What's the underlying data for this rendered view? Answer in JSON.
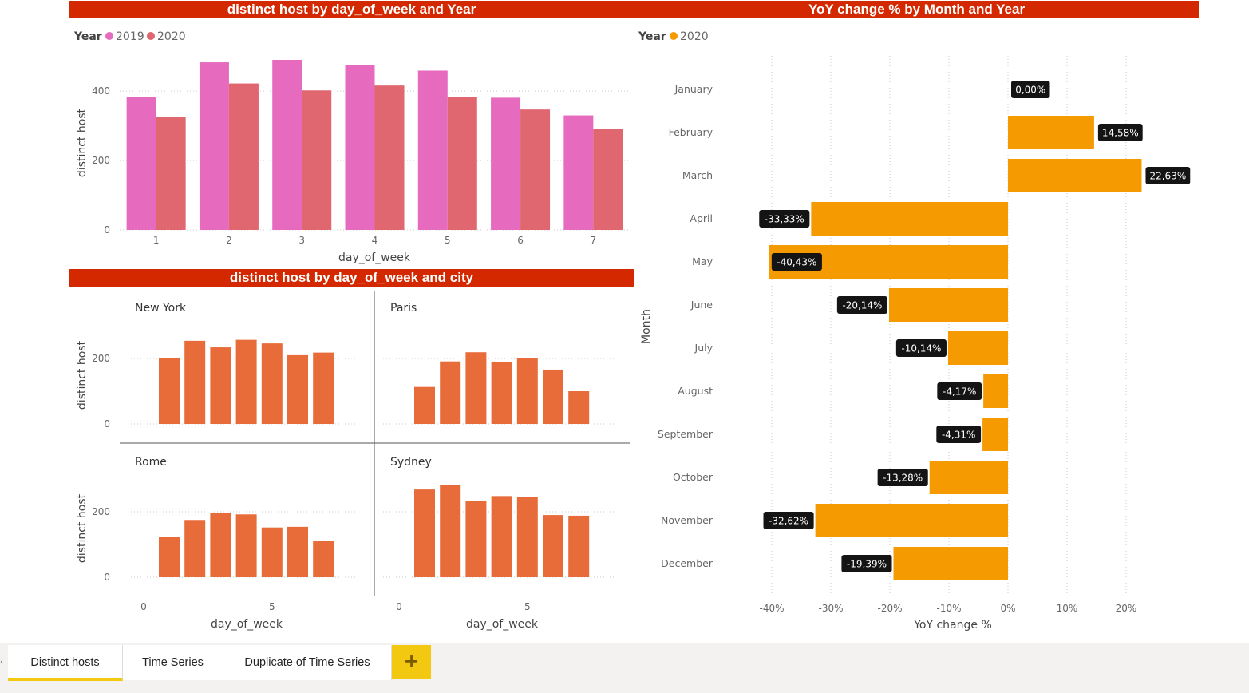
{
  "colors": {
    "title_bg": "#d42800",
    "s2019": "#e66bbe",
    "s2020": "#e0666f",
    "city_bar": "#e86c3a",
    "yoy_bar": "#f59a00",
    "tab_active": "#f2c811"
  },
  "chart1": {
    "title": "distinct host by day_of_week and Year",
    "legend_title": "Year",
    "ylabel": "distinct host",
    "xlabel": "day_of_week",
    "yticks": [
      "0",
      "200",
      "400"
    ]
  },
  "chart2": {
    "title": "distinct host by day_of_week and city",
    "ylabel": "distinct host",
    "xlabel": "day_of_week",
    "yticks": [
      "0",
      "200"
    ],
    "xticks": [
      "0",
      "5"
    ]
  },
  "chart3": {
    "title": "YoY change % by Month and Year",
    "legend_title": "Year",
    "ylabel": "Month",
    "xlabel": "YoY change %",
    "xticks": [
      "-40%",
      "-30%",
      "-20%",
      "-10%",
      "0%",
      "10%",
      "20%"
    ]
  },
  "chart_data": [
    {
      "type": "bar",
      "title": "distinct host by day_of_week and Year",
      "xlabel": "day_of_week",
      "ylabel": "distinct host",
      "categories": [
        "1",
        "2",
        "3",
        "4",
        "5",
        "6",
        "7"
      ],
      "ylim": [
        0,
        490
      ],
      "legend": "top-left",
      "series": [
        {
          "name": "2019",
          "values": [
            383,
            483,
            490,
            476,
            459,
            381,
            330
          ]
        },
        {
          "name": "2020",
          "values": [
            325,
            422,
            402,
            416,
            383,
            347,
            292
          ]
        }
      ]
    },
    {
      "type": "bar",
      "title": "distinct host by day_of_week and city",
      "xlabel": "day_of_week",
      "ylabel": "distinct host",
      "ylim": [
        0,
        300
      ],
      "panels": [
        {
          "name": "New York",
          "x": [
            1,
            2,
            3,
            4,
            5,
            6,
            7
          ],
          "values": [
            200,
            254,
            234,
            257,
            246,
            210,
            218
          ]
        },
        {
          "name": "Paris",
          "x": [
            1,
            2,
            3,
            4,
            5,
            6,
            7
          ],
          "values": [
            113,
            191,
            219,
            188,
            200,
            166,
            100
          ]
        },
        {
          "name": "Rome",
          "x": [
            1,
            2,
            3,
            4,
            5,
            6,
            7
          ],
          "values": [
            122,
            175,
            196,
            192,
            152,
            154,
            110
          ]
        },
        {
          "name": "Sydney",
          "x": [
            1,
            2,
            3,
            4,
            5,
            6,
            7
          ],
          "values": [
            268,
            281,
            234,
            248,
            244,
            190,
            188
          ]
        }
      ]
    },
    {
      "type": "bar",
      "orientation": "horizontal",
      "title": "YoY change % by Month and Year",
      "xlabel": "YoY change %",
      "ylabel": "Month",
      "xlim": [
        -0.4,
        0.2
      ],
      "categories": [
        "January",
        "February",
        "March",
        "April",
        "May",
        "June",
        "July",
        "August",
        "September",
        "October",
        "November",
        "December"
      ],
      "series": [
        {
          "name": "2020",
          "values": [
            0.0,
            14.58,
            22.63,
            -33.33,
            -40.43,
            -20.14,
            -10.14,
            -4.17,
            -4.31,
            -13.28,
            -32.62,
            -19.39
          ],
          "labels": [
            "0,00%",
            "14,58%",
            "22,63%",
            "-33,33%",
            "-40,43%",
            "-20,14%",
            "-10,14%",
            "-4,17%",
            "-4,31%",
            "-13,28%",
            "-32,62%",
            "-19,39%"
          ]
        }
      ]
    }
  ],
  "tabs": [
    {
      "label": "Distinct hosts",
      "active": true
    },
    {
      "label": "Time Series",
      "active": false
    },
    {
      "label": "Duplicate of Time Series",
      "active": false
    }
  ],
  "add_tab_label": "+"
}
